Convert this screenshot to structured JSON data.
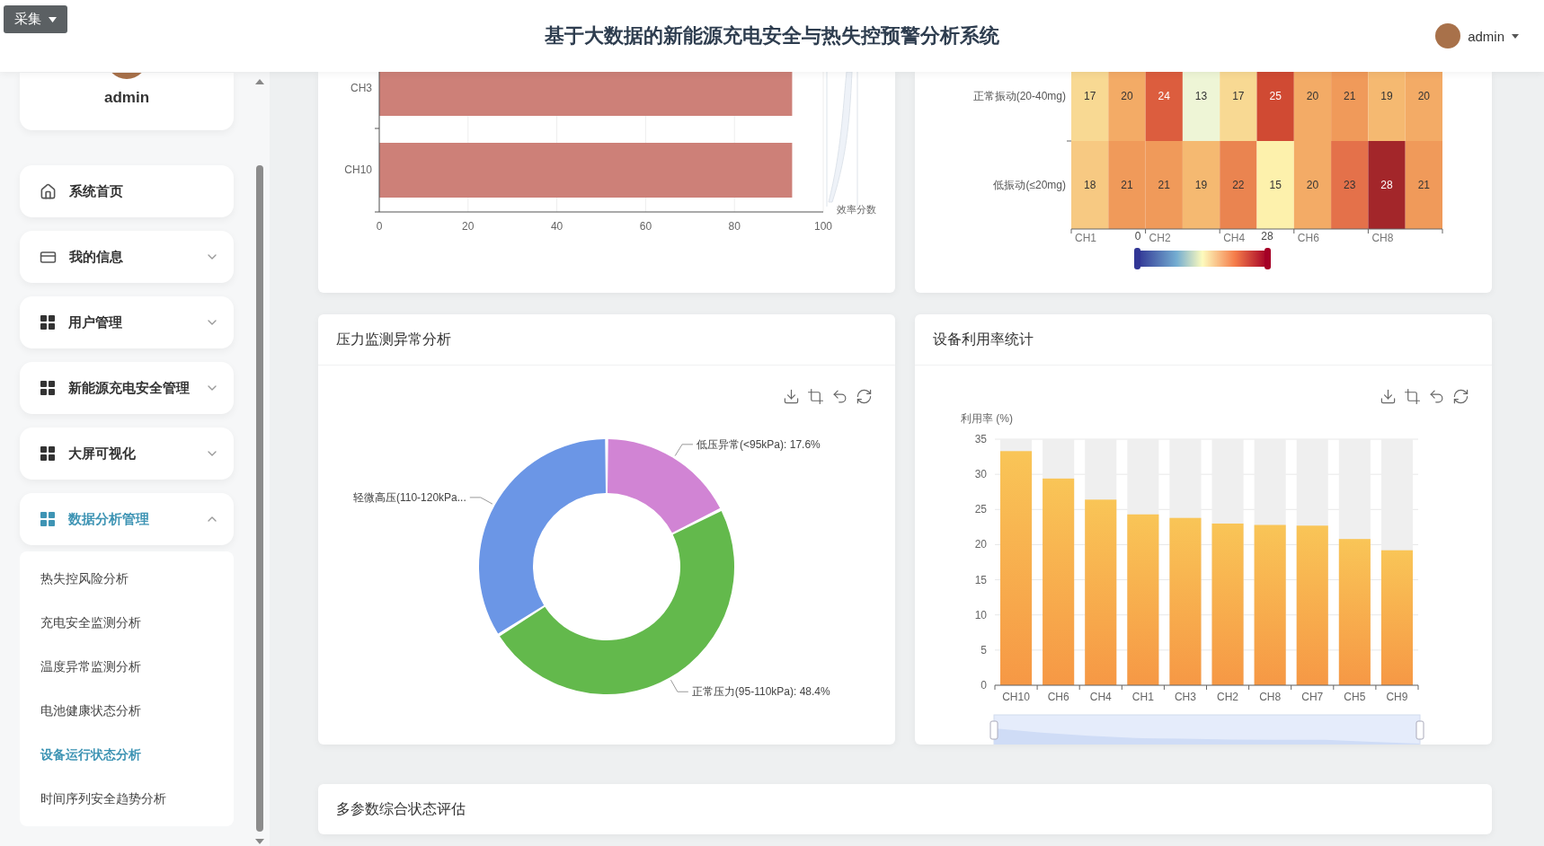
{
  "collect_button": {
    "label": "采集"
  },
  "header": {
    "title": "基于大数据的新能源充电安全与热失控预警分析系统",
    "user": {
      "name": "admin"
    }
  },
  "sidebar": {
    "profile": {
      "name": "admin"
    },
    "menu": [
      {
        "kind": "home",
        "label": "系统首页",
        "selected": false
      },
      {
        "kind": "card",
        "label": "我的信息",
        "selected": false,
        "expanded": false
      },
      {
        "kind": "grid",
        "label": "用户管理",
        "selected": false,
        "expanded": false
      },
      {
        "kind": "grid",
        "label": "新能源充电安全管理",
        "selected": false,
        "expanded": false
      },
      {
        "kind": "grid",
        "label": "大屏可视化",
        "selected": false,
        "expanded": false
      },
      {
        "kind": "grid",
        "label": "数据分析管理",
        "selected": true,
        "expanded": true,
        "children": [
          {
            "label": "热失控风险分析",
            "selected": false
          },
          {
            "label": "充电安全监测分析",
            "selected": false
          },
          {
            "label": "温度异常监测分析",
            "selected": false
          },
          {
            "label": "电池健康状态分析",
            "selected": false
          },
          {
            "label": "设备运行状态分析",
            "selected": true
          },
          {
            "label": "时间序列安全趋势分析",
            "selected": false
          }
        ]
      }
    ]
  },
  "efficiency_card": {
    "side_label": "效率分数",
    "chart_data": {
      "type": "bar",
      "orientation": "horizontal",
      "grid": true,
      "categories": [
        "CH3",
        "CH10"
      ],
      "values": [
        93,
        93
      ],
      "xlim": [
        0,
        100
      ],
      "xticks": [
        0,
        20,
        40,
        60,
        80,
        100
      ]
    }
  },
  "vibration_card": {
    "rows": [
      {
        "label": "正常振动(20-40mg)",
        "values": [
          "17",
          "20",
          "24",
          "13",
          "17",
          "25",
          "20",
          "21",
          "19",
          "20"
        ]
      },
      {
        "label": "低振动(≤20mg)",
        "values": [
          "18",
          "21",
          "21",
          "19",
          "22",
          "15",
          "20",
          "23",
          "28",
          "21"
        ]
      }
    ],
    "x_labels": [
      "CH1",
      "CH2",
      "CH4",
      "CH6",
      "CH8"
    ],
    "scale": {
      "min": "0",
      "max": "28"
    }
  },
  "pressure_card": {
    "title": "压力监测异常分析",
    "slices": [
      {
        "color": "#d184d4"
      },
      {
        "color": "#63b94c"
      },
      {
        "color": "#6b96e6"
      }
    ],
    "chart_data": {
      "type": "donut",
      "categories": [
        "低压异常(<95kPa): 17.6%",
        "正常压力(95-110kPa): 48.4%",
        "轻微高压(110-120kPa..."
      ],
      "values": [
        17.6,
        48.4,
        34.0
      ]
    }
  },
  "utilization_card": {
    "title": "设备利用率统计",
    "chart_data": {
      "type": "bar",
      "orientation": "vertical",
      "grid": true,
      "ylabel": "利用率 (%)",
      "categories": [
        "CH10",
        "CH6",
        "CH4",
        "CH1",
        "CH3",
        "CH2",
        "CH8",
        "CH7",
        "CH5",
        "CH9"
      ],
      "values": [
        33.3,
        29.4,
        26.4,
        24.3,
        23.8,
        23.0,
        22.8,
        22.7,
        20.8,
        19.2
      ],
      "ylim": [
        0,
        35
      ],
      "yticks": [
        0,
        5,
        10,
        15,
        20,
        25,
        30,
        35
      ]
    }
  },
  "assessment_card": {
    "title": "多参数综合状态评估"
  }
}
